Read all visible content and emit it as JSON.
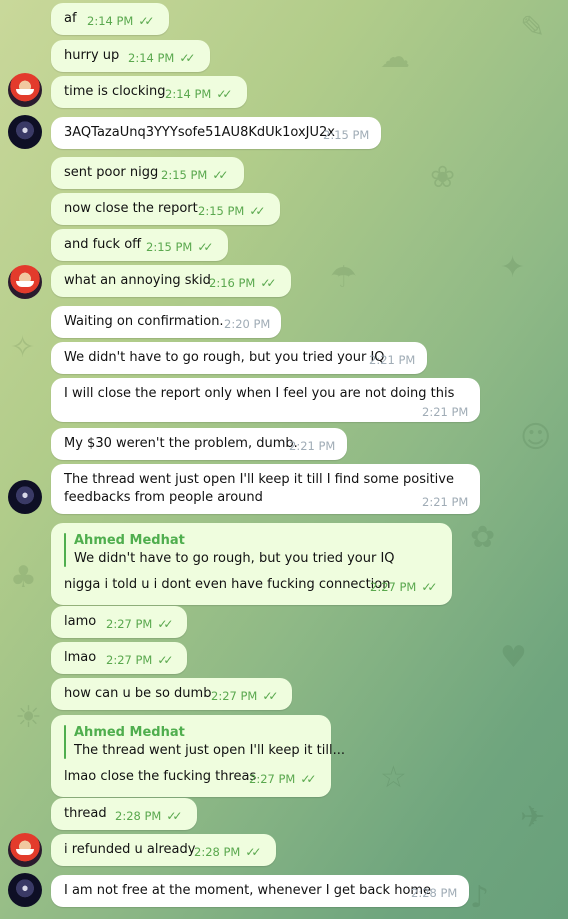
{
  "messages": [
    {
      "text": "af",
      "time": "2:14 PM",
      "ticks": "✓✓"
    },
    {
      "text": "hurry up",
      "time": "2:14 PM",
      "ticks": "✓✓"
    },
    {
      "text": "time is clocking",
      "time": "2:14 PM",
      "ticks": "✓✓"
    },
    {
      "text": "3AQTazaUnq3YYYsofe51AU8KdUk1oxJU2x",
      "time": "2:15 PM"
    },
    {
      "text": "sent poor nigg",
      "time": "2:15 PM",
      "ticks": "✓✓"
    },
    {
      "text": "now close the report",
      "time": "2:15 PM",
      "ticks": "✓✓"
    },
    {
      "text": "and fuck off",
      "time": "2:15 PM",
      "ticks": "✓✓"
    },
    {
      "text": "what an annoying skid",
      "time": "2:16 PM",
      "ticks": "✓✓"
    },
    {
      "text": "Waiting on confirmation.",
      "time": "2:20 PM"
    },
    {
      "text": "We didn't have to go rough, but you tried your IQ",
      "time": "2:21 PM"
    },
    {
      "text": "I will close the report only when I feel you are not doing this",
      "time": "2:21 PM"
    },
    {
      "text": "My $30 weren't the problem, dumb.",
      "time": "2:21 PM"
    },
    {
      "text_line1": "The thread went just open I'll keep it till I find some positive",
      "text_line2": "feedbacks from people around",
      "time": "2:21 PM"
    },
    {
      "reply_name": "Ahmed Medhat",
      "reply_text": "We didn't have to go rough, but you tried your IQ",
      "text": "nigga i told u i dont even have fucking connection",
      "time": "2:27 PM",
      "ticks": "✓✓"
    },
    {
      "text": "lamo",
      "time": "2:27 PM",
      "ticks": "✓✓"
    },
    {
      "text": "lmao",
      "time": "2:27 PM",
      "ticks": "✓✓"
    },
    {
      "text": "how can u be so dumb",
      "time": "2:27 PM",
      "ticks": "✓✓"
    },
    {
      "reply_name": "Ahmed Medhat",
      "reply_text": "The thread went just open I'll keep it till...",
      "text": "lmao close the fucking threas",
      "time": "2:27 PM",
      "ticks": "✓✓"
    },
    {
      "text": "thread",
      "time": "2:28 PM",
      "ticks": "✓✓"
    },
    {
      "text": "i refunded u already",
      "time": "2:28 PM",
      "ticks": "✓✓"
    },
    {
      "text": "I am not free at the moment, whenever I get back  home",
      "time": "2:28 PM"
    }
  ],
  "colors": {
    "outgoing_bubble": "#effdde",
    "incoming_bubble": "#ffffff",
    "accent_green": "#4fae4e"
  },
  "icons": {
    "read_receipt": "double-check-icon"
  }
}
